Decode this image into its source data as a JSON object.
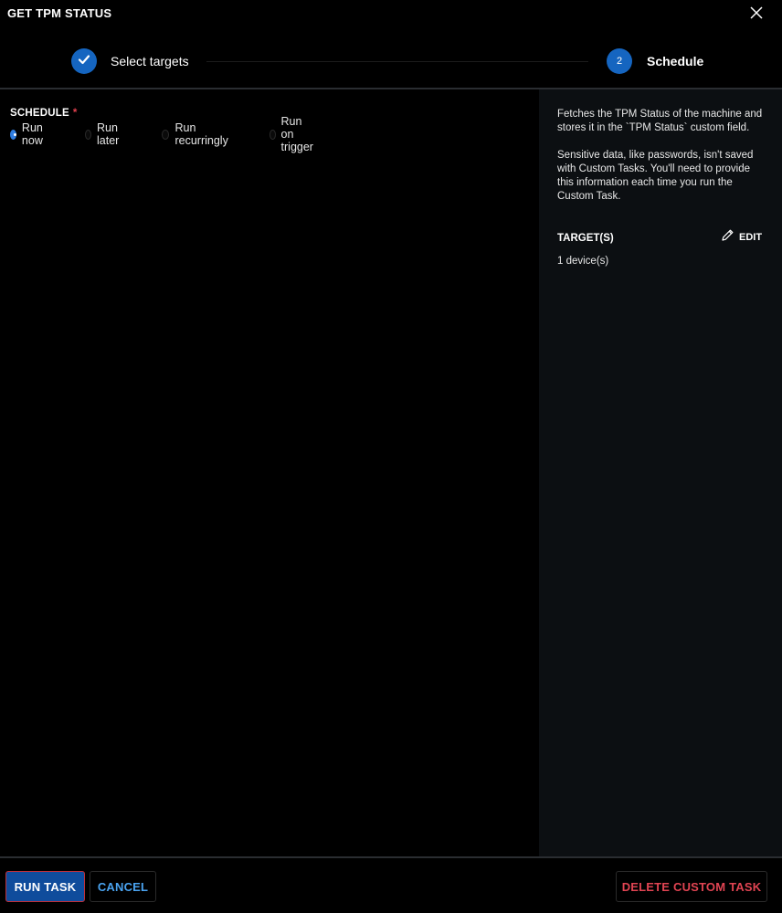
{
  "dialog": {
    "title": "GET TPM STATUS"
  },
  "stepper": {
    "steps": [
      {
        "label": "Select targets",
        "status": "completed",
        "icon": "check-icon"
      },
      {
        "number": "2",
        "label": "Schedule",
        "status": "active"
      }
    ]
  },
  "schedule": {
    "label": "SCHEDULE",
    "required_mark": "*",
    "options": [
      {
        "label": "Run now",
        "selected": true
      },
      {
        "label": "Run later",
        "selected": false
      },
      {
        "label": "Run recurringly",
        "selected": false
      },
      {
        "label": "Run on trigger",
        "selected": false
      }
    ]
  },
  "side_panel": {
    "description": "Fetches the TPM Status of the machine and stores it in the `TPM Status` custom field.",
    "note": "Sensitive data, like passwords, isn't saved with Custom Tasks. You'll need to provide this information each time you run the Custom Task.",
    "targets_label": "TARGET(S)",
    "edit_label": "EDIT",
    "targets_value": "1 device(s)"
  },
  "footer": {
    "run_label": "RUN TASK",
    "cancel_label": "CANCEL",
    "delete_label": "DELETE CUSTOM TASK"
  },
  "colors": {
    "accent": "#1565c0",
    "link": "#4aa3f0",
    "danger": "#e04452",
    "panel_bg": "#0c0f12"
  }
}
